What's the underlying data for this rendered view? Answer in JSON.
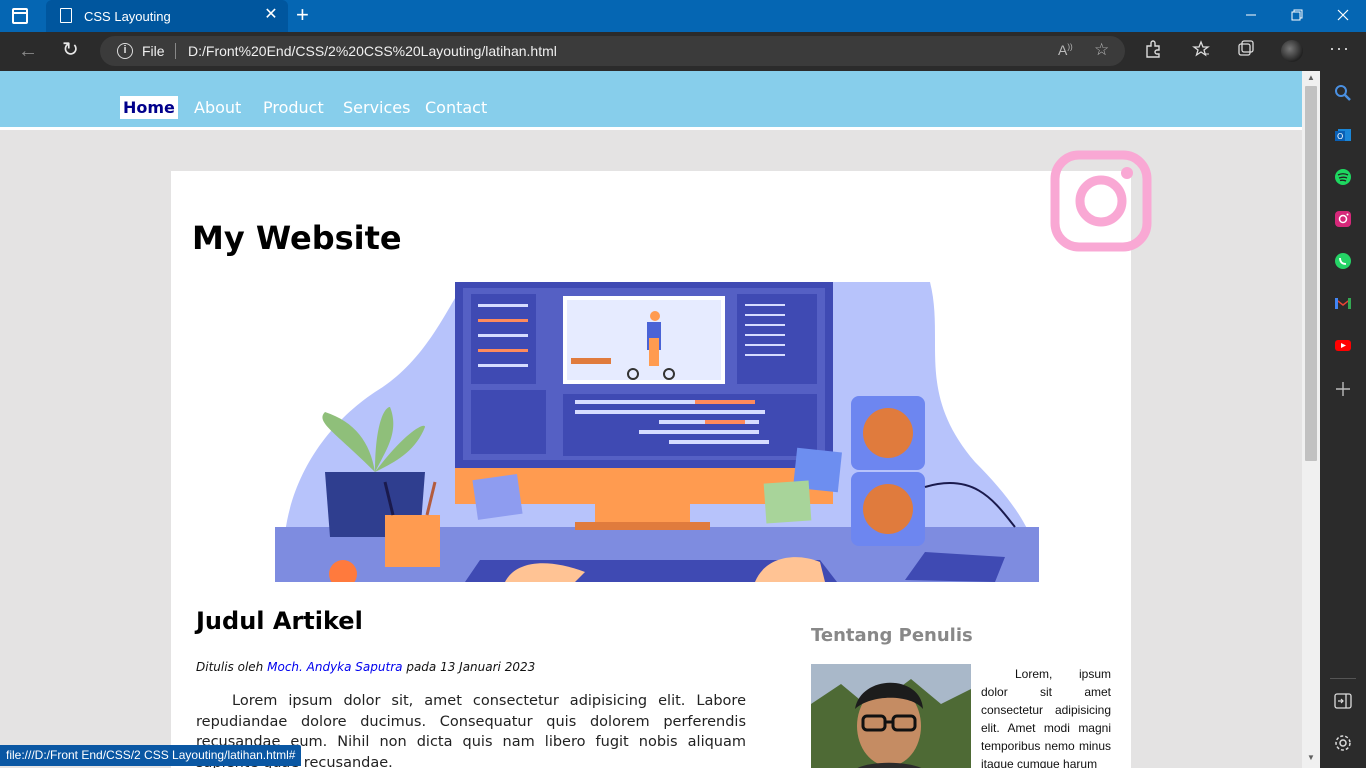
{
  "browser": {
    "tab_title": "CSS Layouting",
    "tab_close": "✕",
    "new_tab": "+",
    "file_label": "File",
    "url": "D:/Front%20End/CSS/2%20CSS%20Layouting/latihan.html",
    "status_url": "file:///D:/Front End/CSS/2 CSS Layouting/latihan.html#"
  },
  "nav": {
    "items": [
      {
        "label": "Home",
        "active": true
      },
      {
        "label": "About"
      },
      {
        "label": "Product"
      },
      {
        "label": "Services"
      },
      {
        "label": "Contact"
      }
    ]
  },
  "site": {
    "title": "My Website"
  },
  "article": {
    "title": "Judul Artikel",
    "byline_prefix": "Ditulis oleh",
    "author": "Moch. Andyka Saputra",
    "byline_suffix": "pada 13 Januari 2023",
    "body": "Lorem ipsum dolor sit, amet consectetur adipisicing elit. Labore repudiandae dolore ducimus. Consequatur quis dolorem perferendis recusandae eum. Nihil non dicta quis nam libero fugit nobis aliquam sapiente quae recusandae."
  },
  "aside": {
    "title": "Tentang Penulis",
    "body": "Lorem, ipsum dolor sit amet consectetur adipisicing elit. Amet modi magni temporibus nemo minus itaque cumque harum"
  },
  "colors": {
    "tabbar": "#0566b3",
    "nav_bg": "#87ceeb",
    "active_nav_text": "#00008b",
    "instagram": "#f9a8d4"
  },
  "icons": {
    "sidebar": [
      "search-icon",
      "outlook-icon",
      "spotify-icon",
      "instagram-icon",
      "whatsapp-icon",
      "gmail-icon",
      "youtube-icon",
      "add-icon",
      "split-screen-icon",
      "settings-icon"
    ]
  }
}
